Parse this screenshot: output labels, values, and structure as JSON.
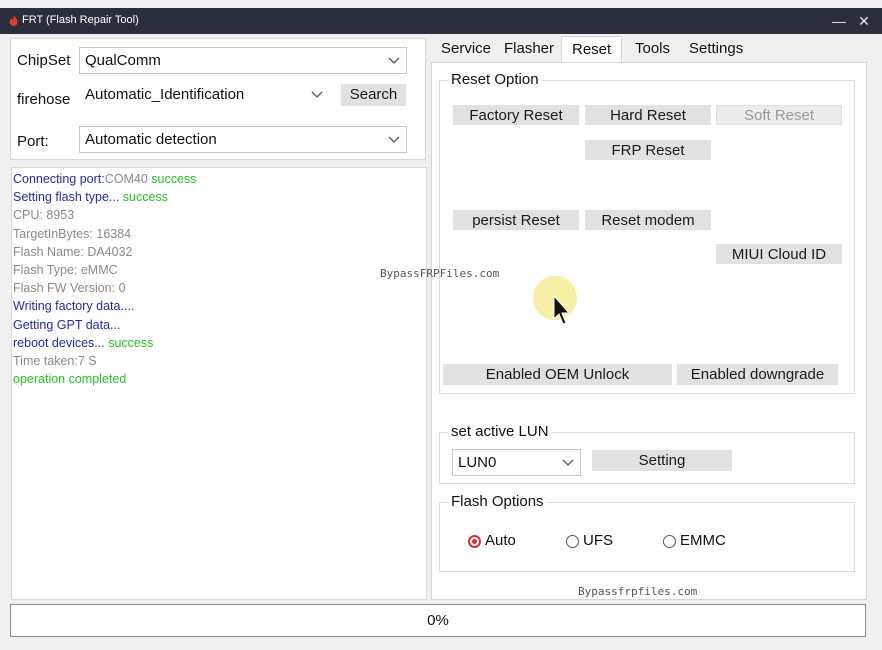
{
  "window": {
    "title": "FRT (Flash Repair Tool)",
    "minimize_glyph": "—",
    "close_glyph": "✕"
  },
  "left": {
    "chipset": {
      "label": "ChipSet",
      "value": "QualComm"
    },
    "firehose": {
      "label": "firehose",
      "value": "Automatic_Identification",
      "search_label": "Search"
    },
    "port": {
      "label": "Port:",
      "value": "Automatic detection"
    }
  },
  "log": [
    {
      "parts": [
        {
          "text": "Connecting port:",
          "color": "blue"
        },
        {
          "text": "COM40 ",
          "color": "gray"
        },
        {
          "text": "success",
          "color": "green"
        }
      ]
    },
    {
      "parts": [
        {
          "text": "Setting flash type... ",
          "color": "blue"
        },
        {
          "text": "success",
          "color": "green"
        }
      ]
    },
    {
      "parts": [
        {
          "text": "CPU: 8953",
          "color": "gray"
        }
      ]
    },
    {
      "parts": [
        {
          "text": "TargetInBytes: 16384",
          "color": "gray"
        }
      ]
    },
    {
      "parts": [
        {
          "text": "Flash Name: DA4032",
          "color": "gray"
        }
      ]
    },
    {
      "parts": [
        {
          "text": "Flash Type: eMMC",
          "color": "gray"
        }
      ]
    },
    {
      "parts": [
        {
          "text": "Flash FW Version: 0",
          "color": "gray"
        }
      ]
    },
    {
      "parts": [
        {
          "text": "Writing factory data....",
          "color": "blue"
        }
      ]
    },
    {
      "parts": [
        {
          "text": "Getting GPT data...",
          "color": "blue"
        }
      ]
    },
    {
      "parts": [
        {
          "text": "reboot devices... ",
          "color": "blue"
        },
        {
          "text": "success",
          "color": "green"
        }
      ]
    },
    {
      "parts": [
        {
          "text": " Time taken:7 S",
          "color": "gray"
        }
      ]
    },
    {
      "parts": [
        {
          "text": "operation completed",
          "color": "green"
        }
      ]
    }
  ],
  "tabs": {
    "service": "Service",
    "flasher": "Flasher",
    "reset": "Reset",
    "tools": "Tools",
    "settings": "Settings",
    "active": "Reset"
  },
  "reset_option": {
    "legend": "Reset Option",
    "factory_reset": "Factory Reset",
    "hard_reset": "Hard Reset",
    "soft_reset": "Soft Reset",
    "frp_reset": "FRP Reset",
    "persist_reset": "persist Reset",
    "reset_modem": "Reset modem",
    "miui_cloud_id": "MIUI Cloud ID",
    "enabled_oem_unlock": "Enabled OEM Unlock",
    "enabled_downgrade": "Enabled downgrade"
  },
  "lun": {
    "legend": "set active LUN",
    "value": "LUN0",
    "setting_label": "Setting"
  },
  "flash_options": {
    "legend": "Flash Options",
    "auto": "Auto",
    "ufs": "UFS",
    "emmc": "EMMC",
    "selected": "Auto"
  },
  "watermarks": {
    "top": "BypassFRPFiles.com",
    "bottom": "Bypassfrpfiles.com"
  },
  "progress": {
    "value": 0,
    "text": "0%"
  },
  "colors": {
    "blue": "#1f2fa0",
    "gray": "#8a8a8a",
    "green": "#27c227",
    "titlebar": "#2b2e3b",
    "radio_accent": "#d92b3a"
  },
  "icons": {
    "app": "flame-app-icon",
    "chevron": "chevron-down-icon",
    "cursor": "mouse-pointer-icon"
  }
}
